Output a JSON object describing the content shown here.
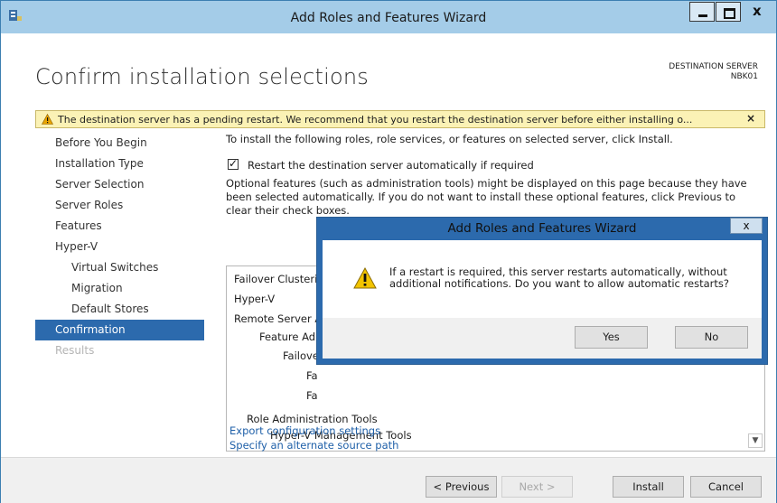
{
  "window": {
    "title": "Add Roles and Features Wizard",
    "close_glyph": "x"
  },
  "header": {
    "page_title": "Confirm installation selections",
    "destination_label": "DESTINATION SERVER",
    "destination_server": "NBK01"
  },
  "warning": {
    "text": "The destination server has a pending restart. We recommend that you restart the destination server before either installing o...",
    "close_glyph": "×"
  },
  "nav": {
    "items": [
      {
        "label": "Before You Begin"
      },
      {
        "label": "Installation Type"
      },
      {
        "label": "Server Selection"
      },
      {
        "label": "Server Roles"
      },
      {
        "label": "Features"
      },
      {
        "label": "Hyper-V"
      },
      {
        "label": "Virtual Switches"
      },
      {
        "label": "Migration"
      },
      {
        "label": "Default Stores"
      },
      {
        "label": "Confirmation"
      },
      {
        "label": "Results"
      }
    ]
  },
  "main": {
    "instruction": "To install the following roles, role services, or features on selected server, click Install.",
    "restart_checkbox_label": "Restart the destination server automatically if required",
    "optional_text": "Optional features (such as administration tools) might be displayed on this page because they have been selected automatically. If you do not want to install these optional features, click Previous to clear their check boxes.",
    "list": [
      "Failover Clusteri",
      "Hyper-V",
      "Remote Server A",
      "Feature Adr",
      "Failove",
      "Fa",
      "Fa",
      "Role Administration Tools",
      "Hyper-V Management Tools"
    ],
    "export_link": "Export configuration settings",
    "alternate_link": "Specify an alternate source path"
  },
  "footer": {
    "previous": "< Previous",
    "next": "Next >",
    "install": "Install",
    "cancel": "Cancel"
  },
  "dialog": {
    "title": "Add Roles and Features Wizard",
    "close_glyph": "x",
    "message": "If a restart is required, this server restarts automatically, without additional notifications. Do you want to allow automatic restarts?",
    "yes": "Yes",
    "no": "No"
  }
}
